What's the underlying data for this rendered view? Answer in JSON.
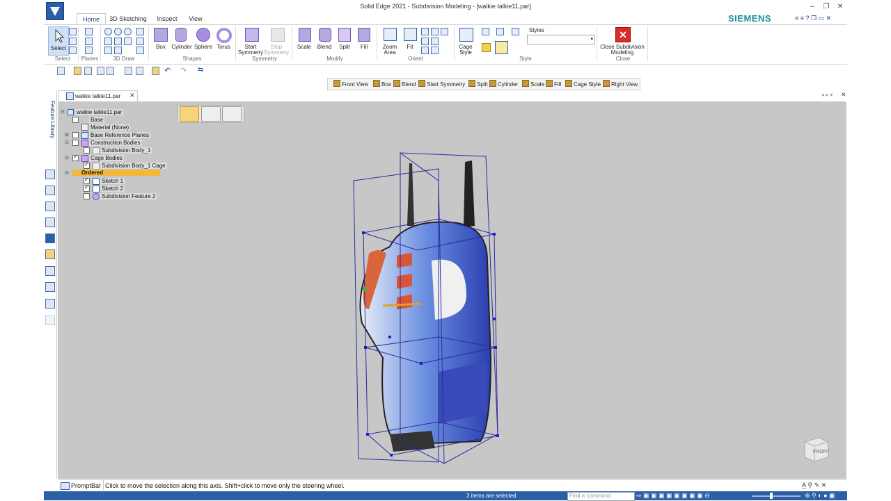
{
  "window": {
    "title": "Solid Edge 2021 - Subdivision Modeling - [walkie talkie11.par]",
    "brand": "SIEMENS"
  },
  "tabs": [
    {
      "label": "Home",
      "active": true
    },
    {
      "label": "3D Sketching",
      "active": false
    },
    {
      "label": "Inspect",
      "active": false
    },
    {
      "label": "View",
      "active": false
    }
  ],
  "ribbon": {
    "select_label": "Select",
    "groups": {
      "select": "Select",
      "planes": "Planes",
      "draw3d": "3D Draw",
      "shapes": "Shapes",
      "symmetry": "Symmetry",
      "modify": "Modify",
      "orient": "Orient",
      "style": "Style",
      "close": "Close"
    },
    "shapes": [
      "Box",
      "Cylinder",
      "Sphere",
      "Torus"
    ],
    "symmetry": {
      "start_l1": "Start",
      "start_l2": "Symmetry",
      "stop_l1": "Stop",
      "stop_l2": "Symmetry"
    },
    "modify": [
      "Scale",
      "Blend",
      "Split",
      "Fill"
    ],
    "orient": {
      "zoom_l1": "Zoom",
      "zoom_l2": "Area",
      "fit": "Fit"
    },
    "cage_style_l1": "Cage",
    "cage_style_l2": "Style",
    "styles_label": "Styles",
    "close_l1": "Close Subdivision",
    "close_l2": "Modeling"
  },
  "command_bar": [
    "Front View",
    "Box",
    "Blend",
    "Start Symmetry",
    "Split",
    "Cylinder",
    "Scale",
    "Fill",
    "Cage Style",
    "Right View"
  ],
  "document_tab": "walkie talkie11.par",
  "feature_library_label": "Feature Library",
  "tree": {
    "root": "walkie talkie11.par",
    "base": "Base",
    "material": "Material (None)",
    "base_ref_planes": "Base Reference Planes",
    "construction_bodies": "Construction Bodies",
    "subdivision_body": "Subdivision Body_1",
    "cage_bodies": "Cage Bodies",
    "cage": "Subdivision Body_1 Cage",
    "ordered": "Ordered",
    "sketch1": "Sketch 1",
    "sketch2": "Sketch 2",
    "feature": "Subdivision Feature 2"
  },
  "viewcube_label": "FRONT",
  "prompt": {
    "label": "PromptBar",
    "message": "Click to move the selection along this axis.  Shift+click to move only the steering wheel."
  },
  "status": {
    "selection": "3 items are selected",
    "find_placeholder": "Find a command"
  },
  "colors": {
    "accent": "#2b5fa8",
    "brand": "#1a8ea0",
    "viewport": "#c7c7c7",
    "ordered_highlight": "#f3b73e",
    "close_button": "#d92b2b"
  }
}
